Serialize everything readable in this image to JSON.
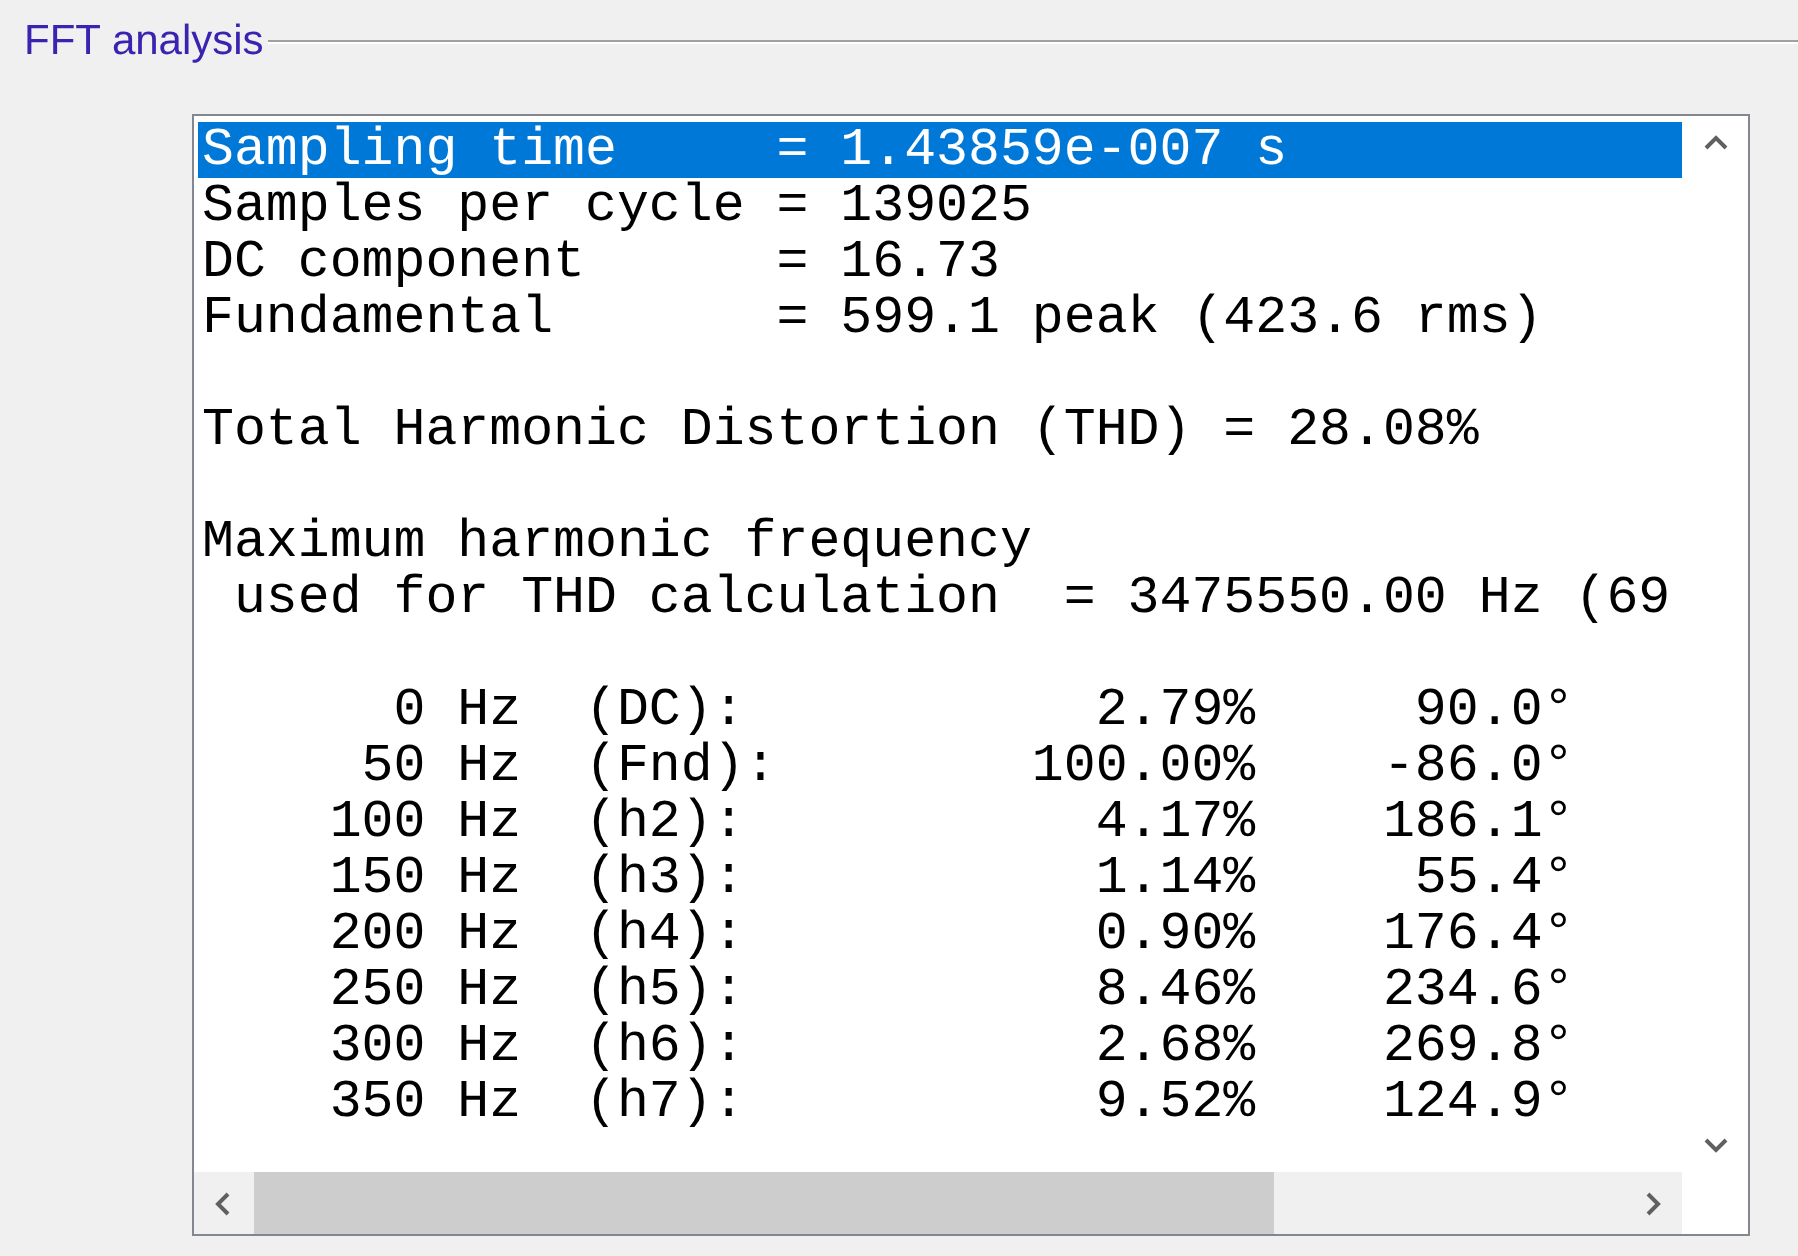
{
  "group": {
    "title": "FFT analysis"
  },
  "listbox": {
    "sections": [
      {
        "lines": [
          {
            "text": "Sampling time     = 1.43859e-007 s",
            "selected": true
          },
          {
            "text": "Samples per cycle = 139025",
            "selected": false
          },
          {
            "text": "DC component      = 16.73",
            "selected": false
          },
          {
            "text": "Fundamental       = 599.1 peak (423.6 rms)",
            "selected": false
          }
        ]
      },
      {
        "lines": [
          {
            "text": "Total Harmonic Distortion (THD) = 28.08%",
            "selected": false
          }
        ]
      },
      {
        "lines": [
          {
            "text": "Maximum harmonic frequency",
            "selected": false
          },
          {
            "text": " used for THD calculation  = 3475550.00 Hz (69",
            "selected": false
          }
        ]
      },
      {
        "lines": [
          {
            "text": "      0 Hz  (DC):           2.79%     90.0°",
            "selected": false
          },
          {
            "text": "     50 Hz  (Fnd):        100.00%    -86.0°",
            "selected": false
          },
          {
            "text": "    100 Hz  (h2):           4.17%    186.1°",
            "selected": false
          },
          {
            "text": "    150 Hz  (h3):           1.14%     55.4°",
            "selected": false
          },
          {
            "text": "    200 Hz  (h4):           0.90%    176.4°",
            "selected": false
          },
          {
            "text": "    250 Hz  (h5):           8.46%    234.6°",
            "selected": false
          },
          {
            "text": "    300 Hz  (h6):           2.68%    269.8°",
            "selected": false
          },
          {
            "text": "    350 Hz  (h7):           9.52%    124.9°",
            "selected": false
          }
        ]
      }
    ]
  }
}
